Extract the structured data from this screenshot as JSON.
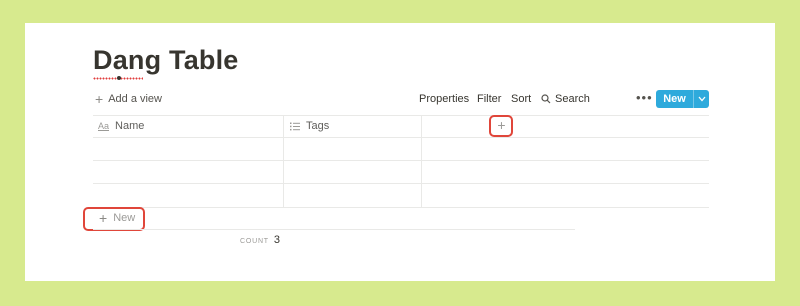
{
  "page": {
    "title": "Dang Table"
  },
  "toolbar": {
    "add_view_label": "Add a view",
    "properties_label": "Properties",
    "filter_label": "Filter",
    "sort_label": "Sort",
    "search_label": "Search",
    "more_label": "•••",
    "new_label": "New"
  },
  "table": {
    "columns": [
      {
        "label": "Name",
        "icon": "text-property-icon"
      },
      {
        "label": "Tags",
        "icon": "multi-select-list-icon"
      }
    ],
    "add_column_label": "+",
    "rows": [
      {
        "name": "",
        "tags": ""
      },
      {
        "name": "",
        "tags": ""
      },
      {
        "name": "",
        "tags": ""
      }
    ],
    "new_row_label": "New",
    "count_label": "COUNT",
    "count_value": "3"
  },
  "colors": {
    "background": "#d7ea8e",
    "panel": "#ffffff",
    "accent": "#2eaadc",
    "highlight": "#e0463a",
    "gridline": "#e9e9e7"
  }
}
